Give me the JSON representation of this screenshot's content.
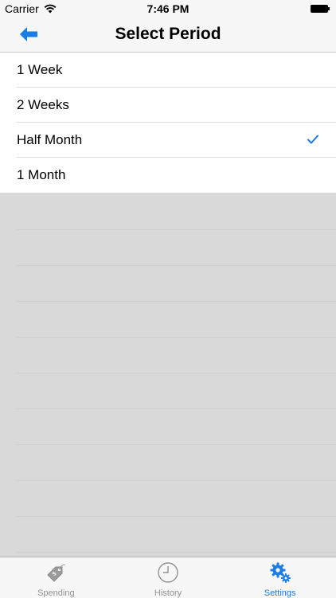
{
  "status_bar": {
    "carrier": "Carrier",
    "time": "7:46 PM"
  },
  "nav": {
    "title": "Select Period"
  },
  "list": {
    "items": [
      {
        "label": "1 Week",
        "selected": false
      },
      {
        "label": "2 Weeks",
        "selected": false
      },
      {
        "label": "Half Month",
        "selected": true
      },
      {
        "label": "1 Month",
        "selected": false
      }
    ]
  },
  "tabs": [
    {
      "label": "Spending",
      "icon": "price-tag-icon",
      "active": false
    },
    {
      "label": "History",
      "icon": "clock-icon",
      "active": false
    },
    {
      "label": "Settings",
      "icon": "gears-icon",
      "active": true
    }
  ],
  "colors": {
    "accent": "#1a7ce4",
    "inactive": "#929292",
    "background": "#d9d9d9"
  }
}
